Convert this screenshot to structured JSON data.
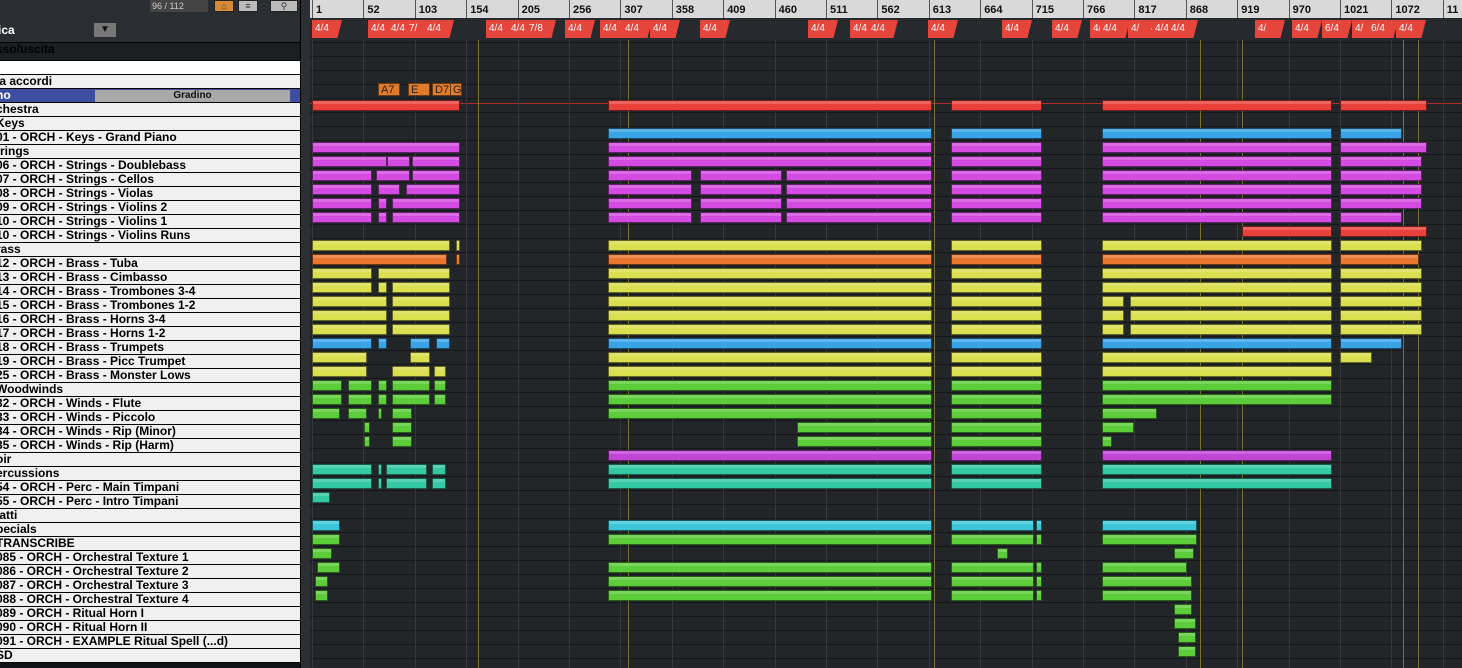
{
  "toolbar": {
    "counter": "96 / 112",
    "dropdown_label": "ica"
  },
  "tracks": [
    {
      "name": "sso/uscita",
      "style": "tall2"
    },
    {
      "name": "",
      "style": "blank"
    },
    {
      "name": "ia accordi",
      "style": ""
    },
    {
      "name": "no",
      "style": "sel",
      "extra": "Gradino"
    },
    {
      "name": "chestra",
      "style": ""
    },
    {
      "name": "Keys",
      "style": ""
    },
    {
      "name": "01 - ORCH - Keys - Grand Piano",
      "style": ""
    },
    {
      "name": "trings",
      "style": ""
    },
    {
      "name": "06 - ORCH - Strings - Doublebass",
      "style": ""
    },
    {
      "name": "07 - ORCH - Strings - Cellos",
      "style": ""
    },
    {
      "name": "08 - ORCH - Strings - Violas",
      "style": ""
    },
    {
      "name": "09 - ORCH - Strings - Violins 2",
      "style": ""
    },
    {
      "name": "10 - ORCH - Strings - Violins 1",
      "style": ""
    },
    {
      "name": "10 - ORCH - Strings - Violins Runs",
      "style": ""
    },
    {
      "name": "rass",
      "style": ""
    },
    {
      "name": "12 - ORCH - Brass - Tuba",
      "style": ""
    },
    {
      "name": "13 - ORCH - Brass - Cimbasso",
      "style": ""
    },
    {
      "name": "14 - ORCH - Brass - Trombones 3-4",
      "style": ""
    },
    {
      "name": "15 - ORCH - Brass - Trombones 1-2",
      "style": ""
    },
    {
      "name": "16 - ORCH - Brass - Horns 3-4",
      "style": ""
    },
    {
      "name": "17 - ORCH - Brass - Horns 1-2",
      "style": ""
    },
    {
      "name": "18 - ORCH - Brass - Trumpets",
      "style": ""
    },
    {
      "name": "19 - ORCH - Brass - Picc Trumpet",
      "style": ""
    },
    {
      "name": "25 - ORCH - Brass - Monster Lows",
      "style": ""
    },
    {
      "name": "Woodwinds",
      "style": ""
    },
    {
      "name": "32 - ORCH - Winds - Flute",
      "style": ""
    },
    {
      "name": "33 - ORCH - Winds - Piccolo",
      "style": ""
    },
    {
      "name": "34 - ORCH - Winds - Rip (Minor)",
      "style": ""
    },
    {
      "name": "35 - ORCH - Winds - Rip (Harm)",
      "style": ""
    },
    {
      "name": "oir",
      "style": ""
    },
    {
      "name": "ercussions",
      "style": ""
    },
    {
      "name": "54 - ORCH - Perc - Main Timpani",
      "style": ""
    },
    {
      "name": "55 - ORCH - Perc - Intro Timpani",
      "style": ""
    },
    {
      "name": "iatti",
      "style": ""
    },
    {
      "name": "pecials",
      "style": ""
    },
    {
      "name": " TRANSCRIBE",
      "style": ""
    },
    {
      "name": "085 - ORCH - Orchestral Texture 1",
      "style": ""
    },
    {
      "name": "086 - ORCH - Orchestral Texture 2",
      "style": ""
    },
    {
      "name": "087 - ORCH - Orchestral Texture 3",
      "style": ""
    },
    {
      "name": "088 - ORCH - Orchestral Texture 4",
      "style": ""
    },
    {
      "name": "089 - ORCH - Ritual Horn I",
      "style": ""
    },
    {
      "name": "090 - ORCH - Ritual Horn II",
      "style": ""
    },
    {
      "name": "091 - ORCH - EXAMPLE Ritual Spell (...d)",
      "style": ""
    },
    {
      "name": "SD",
      "style": ""
    }
  ],
  "ruler": {
    "bars": [
      "1",
      "52",
      "103",
      "154",
      "205",
      "256",
      "307",
      "358",
      "409",
      "460",
      "511",
      "562",
      "613",
      "664",
      "715",
      "766",
      "817",
      "868",
      "919",
      "970",
      "1021",
      "1072",
      "11"
    ]
  },
  "signatures": [
    "4/4",
    "4/4",
    "4/4",
    "7/",
    "4/4",
    "4/4",
    "4/4",
    "7/8",
    "4/4",
    "4/4",
    "4/4",
    "4/4",
    "4/4",
    "4/4",
    "4/4",
    "4/4",
    "4/4",
    "4/4",
    "4/4",
    "4/",
    "4/4",
    "4/",
    "4/4",
    "4/4",
    "4/4",
    "4/",
    "4/4",
    "6/4",
    "4/",
    "6/4",
    "4/4"
  ],
  "chords": [
    "A7",
    "E",
    "D7",
    "G"
  ],
  "colors": {
    "red": "#e8403a",
    "blue": "#3aa3e6",
    "magenta": "#d34be0",
    "yellow": "#d9df4f",
    "orange": "#e9772f",
    "green": "#5ccc3a",
    "teal": "#35c9a3",
    "cyan": "#3cc6d8",
    "purple": "#c246d6"
  },
  "clips": [
    {
      "row": 4,
      "color": "red",
      "spans": [
        [
          0,
          148
        ],
        [
          296,
          620
        ],
        [
          639,
          730
        ],
        [
          790,
          1020
        ],
        [
          1028,
          1115
        ]
      ]
    },
    {
      "row": 6,
      "color": "blue",
      "spans": [
        [
          296,
          620
        ],
        [
          639,
          730
        ],
        [
          790,
          1020
        ],
        [
          1028,
          1090
        ]
      ]
    },
    {
      "row": 7,
      "color": "magenta",
      "spans": [
        [
          0,
          148
        ],
        [
          296,
          620
        ],
        [
          639,
          730
        ],
        [
          790,
          1020
        ],
        [
          1028,
          1115
        ]
      ]
    },
    {
      "row": 8,
      "color": "magenta",
      "spans": [
        [
          0,
          75
        ],
        [
          75,
          98
        ],
        [
          100,
          148
        ],
        [
          296,
          620
        ],
        [
          639,
          730
        ],
        [
          790,
          1020
        ],
        [
          1028,
          1110
        ]
      ]
    },
    {
      "row": 9,
      "color": "magenta",
      "spans": [
        [
          0,
          60
        ],
        [
          64,
          98
        ],
        [
          100,
          148
        ],
        [
          296,
          380
        ],
        [
          388,
          470
        ],
        [
          474,
          620
        ],
        [
          639,
          730
        ],
        [
          790,
          1020
        ],
        [
          1028,
          1110
        ]
      ]
    },
    {
      "row": 10,
      "color": "magenta",
      "spans": [
        [
          0,
          60
        ],
        [
          66,
          88
        ],
        [
          94,
          148
        ],
        [
          296,
          380
        ],
        [
          388,
          470
        ],
        [
          474,
          620
        ],
        [
          639,
          730
        ],
        [
          790,
          1020
        ],
        [
          1028,
          1110
        ]
      ]
    },
    {
      "row": 11,
      "color": "magenta",
      "spans": [
        [
          0,
          60
        ],
        [
          66,
          75
        ],
        [
          80,
          148
        ],
        [
          296,
          380
        ],
        [
          388,
          470
        ],
        [
          474,
          620
        ],
        [
          639,
          730
        ],
        [
          790,
          1020
        ],
        [
          1028,
          1110
        ]
      ]
    },
    {
      "row": 12,
      "color": "magenta",
      "spans": [
        [
          0,
          60
        ],
        [
          66,
          75
        ],
        [
          80,
          148
        ],
        [
          296,
          380
        ],
        [
          388,
          470
        ],
        [
          474,
          620
        ],
        [
          639,
          730
        ],
        [
          790,
          1020
        ],
        [
          1028,
          1090
        ]
      ]
    },
    {
      "row": 13,
      "color": "red",
      "spans": [
        [
          930,
          1020
        ],
        [
          1028,
          1115
        ]
      ]
    },
    {
      "row": 14,
      "color": "yellow",
      "spans": [
        [
          0,
          138
        ],
        [
          144,
          148
        ],
        [
          296,
          620
        ],
        [
          639,
          730
        ],
        [
          790,
          1020
        ],
        [
          1028,
          1110
        ]
      ]
    },
    {
      "row": 15,
      "color": "orange",
      "spans": [
        [
          0,
          135
        ],
        [
          144,
          148
        ],
        [
          296,
          620
        ],
        [
          639,
          730
        ],
        [
          790,
          1020
        ],
        [
          1028,
          1107
        ]
      ]
    },
    {
      "row": 16,
      "color": "yellow",
      "spans": [
        [
          0,
          60
        ],
        [
          66,
          138
        ],
        [
          296,
          620
        ],
        [
          639,
          730
        ],
        [
          790,
          1020
        ],
        [
          1028,
          1110
        ]
      ]
    },
    {
      "row": 17,
      "color": "yellow",
      "spans": [
        [
          0,
          60
        ],
        [
          66,
          75
        ],
        [
          80,
          138
        ],
        [
          296,
          620
        ],
        [
          639,
          730
        ],
        [
          790,
          1020
        ],
        [
          1028,
          1110
        ]
      ]
    },
    {
      "row": 18,
      "color": "yellow",
      "spans": [
        [
          0,
          75
        ],
        [
          80,
          138
        ],
        [
          296,
          620
        ],
        [
          639,
          730
        ],
        [
          790,
          812
        ],
        [
          818,
          1020
        ],
        [
          1028,
          1110
        ]
      ]
    },
    {
      "row": 19,
      "color": "yellow",
      "spans": [
        [
          0,
          75
        ],
        [
          80,
          138
        ],
        [
          296,
          620
        ],
        [
          639,
          730
        ],
        [
          790,
          812
        ],
        [
          818,
          1020
        ],
        [
          1028,
          1110
        ]
      ]
    },
    {
      "row": 20,
      "color": "yellow",
      "spans": [
        [
          0,
          75
        ],
        [
          80,
          138
        ],
        [
          296,
          620
        ],
        [
          639,
          730
        ],
        [
          790,
          812
        ],
        [
          818,
          1020
        ],
        [
          1028,
          1110
        ]
      ]
    },
    {
      "row": 21,
      "color": "blue",
      "spans": [
        [
          0,
          60
        ],
        [
          66,
          75
        ],
        [
          98,
          118
        ],
        [
          124,
          138
        ],
        [
          296,
          620
        ],
        [
          639,
          730
        ],
        [
          790,
          1020
        ],
        [
          1028,
          1090
        ]
      ]
    },
    {
      "row": 22,
      "color": "yellow",
      "spans": [
        [
          0,
          55
        ],
        [
          98,
          118
        ],
        [
          296,
          620
        ],
        [
          639,
          730
        ],
        [
          790,
          1020
        ],
        [
          1028,
          1060
        ]
      ]
    },
    {
      "row": 23,
      "color": "yellow",
      "spans": [
        [
          0,
          55
        ],
        [
          80,
          118
        ],
        [
          122,
          134
        ],
        [
          296,
          620
        ],
        [
          639,
          730
        ],
        [
          790,
          1020
        ]
      ]
    },
    {
      "row": 24,
      "color": "green",
      "spans": [
        [
          0,
          30
        ],
        [
          36,
          60
        ],
        [
          66,
          75
        ],
        [
          80,
          118
        ],
        [
          122,
          134
        ],
        [
          296,
          620
        ],
        [
          639,
          730
        ],
        [
          790,
          1020
        ]
      ]
    },
    {
      "row": 25,
      "color": "green",
      "spans": [
        [
          0,
          30
        ],
        [
          36,
          60
        ],
        [
          66,
          75
        ],
        [
          80,
          118
        ],
        [
          122,
          134
        ],
        [
          296,
          620
        ],
        [
          639,
          730
        ],
        [
          790,
          1020
        ]
      ]
    },
    {
      "row": 26,
      "color": "green",
      "spans": [
        [
          0,
          28
        ],
        [
          36,
          55
        ],
        [
          66,
          70
        ],
        [
          80,
          100
        ],
        [
          296,
          620
        ],
        [
          639,
          730
        ],
        [
          790,
          845
        ]
      ]
    },
    {
      "row": 27,
      "color": "green",
      "spans": [
        [
          52,
          58
        ],
        [
          80,
          100
        ],
        [
          485,
          620
        ],
        [
          639,
          730
        ],
        [
          790,
          822
        ]
      ]
    },
    {
      "row": 28,
      "color": "green",
      "spans": [
        [
          52,
          58
        ],
        [
          80,
          100
        ],
        [
          485,
          620
        ],
        [
          639,
          730
        ],
        [
          790,
          800
        ]
      ]
    },
    {
      "row": 29,
      "color": "purple",
      "spans": [
        [
          296,
          620
        ],
        [
          639,
          730
        ],
        [
          790,
          1020
        ]
      ]
    },
    {
      "row": 30,
      "color": "teal",
      "spans": [
        [
          0,
          60
        ],
        [
          66,
          70
        ],
        [
          74,
          115
        ],
        [
          120,
          134
        ],
        [
          296,
          620
        ],
        [
          639,
          730
        ],
        [
          790,
          1020
        ]
      ]
    },
    {
      "row": 31,
      "color": "teal",
      "spans": [
        [
          0,
          60
        ],
        [
          66,
          70
        ],
        [
          74,
          115
        ],
        [
          120,
          134
        ],
        [
          296,
          620
        ],
        [
          639,
          730
        ],
        [
          790,
          1020
        ]
      ]
    },
    {
      "row": 32,
      "color": "teal",
      "spans": [
        [
          0,
          18
        ]
      ]
    },
    {
      "row": 34,
      "color": "cyan",
      "spans": [
        [
          0,
          28
        ],
        [
          296,
          620
        ],
        [
          639,
          722
        ],
        [
          724,
          730
        ],
        [
          790,
          885
        ]
      ]
    },
    {
      "row": 35,
      "color": "green",
      "spans": [
        [
          0,
          28
        ],
        [
          296,
          620
        ],
        [
          639,
          722
        ],
        [
          724,
          730
        ],
        [
          790,
          885
        ]
      ]
    },
    {
      "row": 36,
      "color": "green",
      "spans": [
        [
          0,
          20
        ],
        [
          685,
          696
        ],
        [
          862,
          882
        ]
      ]
    },
    {
      "row": 37,
      "color": "green",
      "spans": [
        [
          5,
          28
        ],
        [
          296,
          620
        ],
        [
          639,
          722
        ],
        [
          724,
          730
        ],
        [
          790,
          875
        ]
      ]
    },
    {
      "row": 38,
      "color": "green",
      "spans": [
        [
          3,
          16
        ],
        [
          296,
          620
        ],
        [
          639,
          722
        ],
        [
          724,
          730
        ],
        [
          790,
          880
        ]
      ]
    },
    {
      "row": 39,
      "color": "green",
      "spans": [
        [
          3,
          16
        ],
        [
          296,
          620
        ],
        [
          639,
          722
        ],
        [
          724,
          730
        ],
        [
          790,
          880
        ]
      ]
    },
    {
      "row": 40,
      "color": "green",
      "spans": [
        [
          862,
          880
        ]
      ]
    },
    {
      "row": 41,
      "color": "green",
      "spans": [
        [
          862,
          884
        ]
      ]
    },
    {
      "row": 42,
      "color": "green",
      "spans": [
        [
          866,
          884
        ]
      ]
    },
    {
      "row": 43,
      "color": "green",
      "spans": [
        [
          866,
          884
        ]
      ]
    }
  ]
}
